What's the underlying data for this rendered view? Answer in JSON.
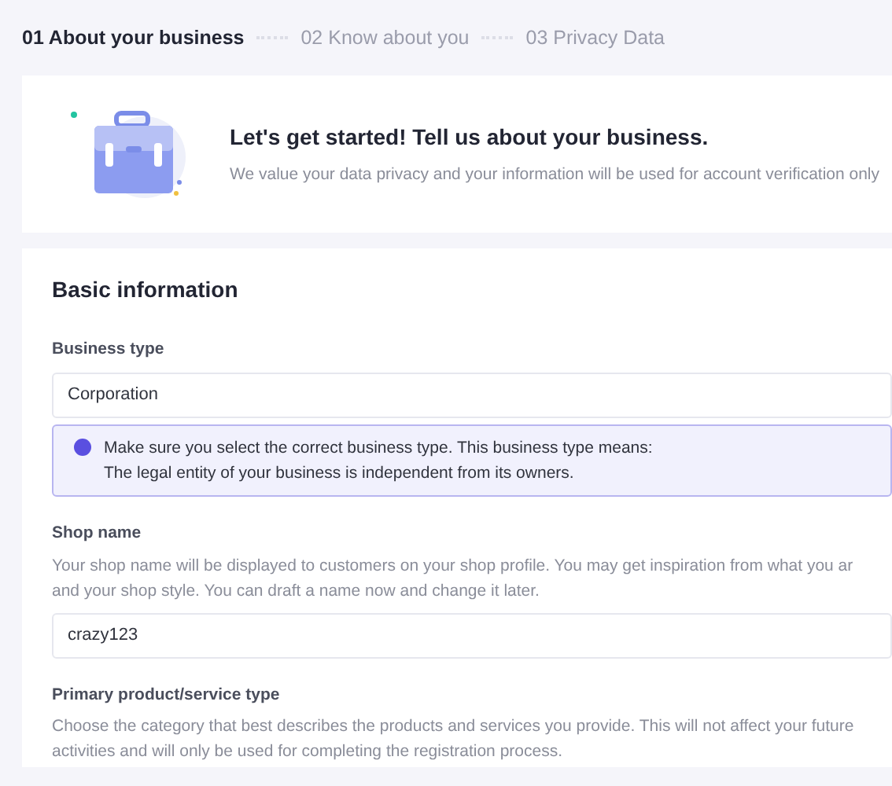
{
  "steps": [
    {
      "label": "01 About your business",
      "selected": true
    },
    {
      "label": "02 Know about you",
      "selected": false
    },
    {
      "label": "03 Privacy Data",
      "selected": false
    }
  ],
  "intro": {
    "title": "Let's get started! Tell us about your business.",
    "subtitle": "We value your data privacy and your information will be used for account verification only"
  },
  "section": {
    "title": "Basic information"
  },
  "fields": [
    {
      "kind": "input",
      "label": "Business type",
      "value": "Corporation",
      "notice": [
        "Make sure you select the correct business type. This business type means:",
        "The legal entity of your business is independent from its owners."
      ]
    },
    {
      "kind": "input",
      "label": "Shop name",
      "description": [
        "Your shop name will be displayed to customers on your shop profile. You may get inspiration from what you ar",
        "and your shop style. You can draft a name now and change it later."
      ],
      "value": "crazy123"
    },
    {
      "kind": "text",
      "label": "Primary product/service type",
      "description": [
        "Choose the category that best describes the products and services you provide. This will not affect your future",
        "activities and will only be used for completing the registration process."
      ]
    }
  ]
}
